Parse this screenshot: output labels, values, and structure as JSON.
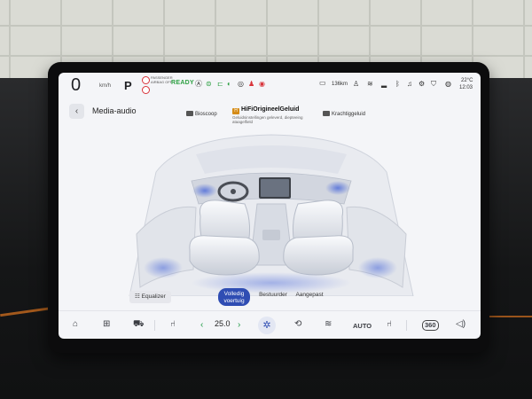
{
  "status": {
    "speed": "0",
    "speed_unit": "km/h",
    "gear": "P",
    "airbag_text": "PASSENGER AIRBAG OFF",
    "ready": "READY",
    "range": "136km",
    "temperature": "22°C",
    "time": "12:03",
    "warning_color": "#d8333a",
    "ready_color": "#2ea043"
  },
  "header": {
    "title": "Media-audio",
    "modes": {
      "cinema": "Bioscoop",
      "hifi_badge": "H",
      "hifi": "HiFiOrigineelGeluid",
      "hifi_sub": "Geluidsinstellingen geleverd, diepteeing ataagelfield",
      "power": "Krachtiggeluid"
    }
  },
  "controls": {
    "equalizer": "Equalizer",
    "sound_focus": {
      "full_vehicle": "Volledig voertuig",
      "driver": "Bestuurder",
      "custom": "Aangepast",
      "selected": "full_vehicle"
    }
  },
  "dock": {
    "temperature": "25.0",
    "auto": "AUTO",
    "view360": "360",
    "accent_color": "#2f4db3",
    "temp_arrow_color": "#1f9b45"
  }
}
